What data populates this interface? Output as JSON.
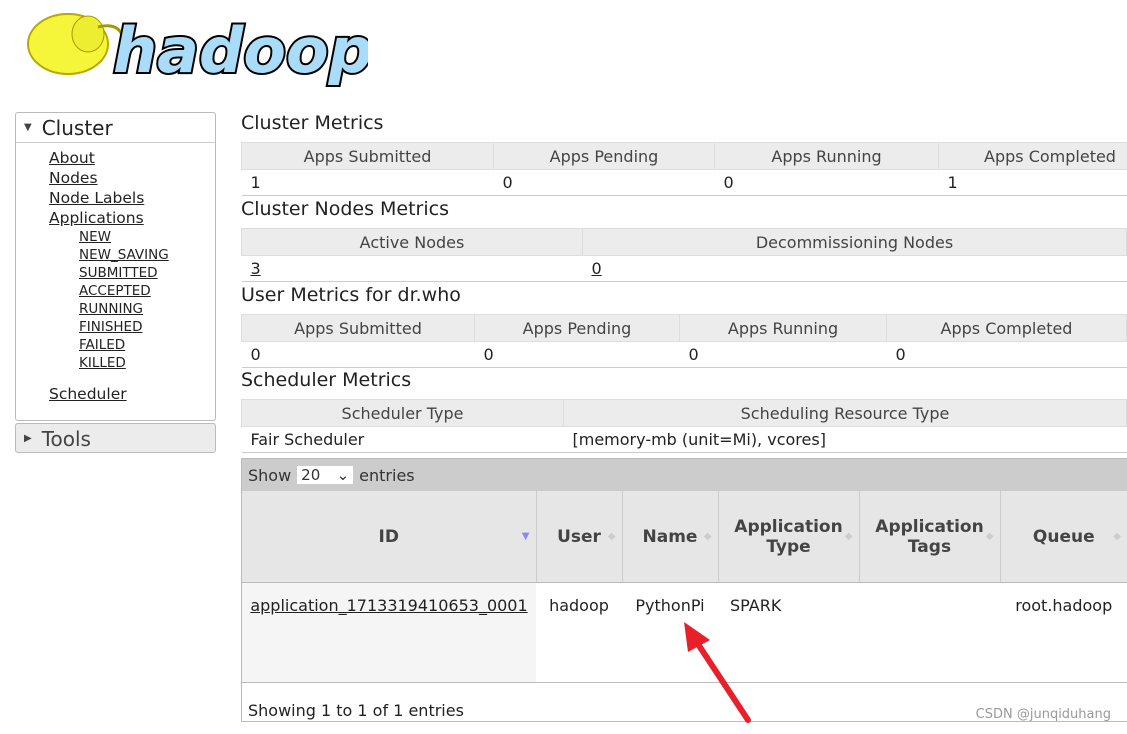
{
  "logo": {
    "text": "hadoop"
  },
  "sidebar": {
    "cluster": {
      "title": "Cluster",
      "items": [
        "About",
        "Nodes",
        "Node Labels",
        "Applications"
      ],
      "app_states": [
        "NEW",
        "NEW_SAVING",
        "SUBMITTED",
        "ACCEPTED",
        "RUNNING",
        "FINISHED",
        "FAILED",
        "KILLED"
      ],
      "scheduler": "Scheduler"
    },
    "tools": {
      "title": "Tools"
    }
  },
  "cluster_metrics": {
    "title": "Cluster Metrics",
    "headers": [
      "Apps Submitted",
      "Apps Pending",
      "Apps Running",
      "Apps Completed"
    ],
    "values": [
      "1",
      "0",
      "0",
      "1"
    ]
  },
  "nodes_metrics": {
    "title": "Cluster Nodes Metrics",
    "headers": [
      "Active Nodes",
      "Decommissioning Nodes"
    ],
    "values": [
      "3",
      "0"
    ]
  },
  "user_metrics": {
    "title": "User Metrics for dr.who",
    "headers": [
      "Apps Submitted",
      "Apps Pending",
      "Apps Running",
      "Apps Completed"
    ],
    "values": [
      "0",
      "0",
      "0",
      "0"
    ]
  },
  "scheduler_metrics": {
    "title": "Scheduler Metrics",
    "headers": [
      "Scheduler Type",
      "Scheduling Resource Type"
    ],
    "values": [
      "Fair Scheduler",
      "[memory-mb (unit=Mi), vcores]"
    ]
  },
  "apps_table": {
    "show": "Show",
    "page_size": "20",
    "entries": "entries",
    "headers": [
      "ID",
      "User",
      "Name",
      "Application Type",
      "Application Tags",
      "Queue"
    ],
    "rows": [
      {
        "id": "application_1713319410653_0001",
        "user": "hadoop",
        "name": "PythonPi",
        "type": "SPARK",
        "tags": "",
        "queue": "root.hadoop"
      }
    ],
    "footer": "Showing 1 to 1 of 1 entries"
  },
  "watermark": "CSDN @junqiduhang",
  "colors": {
    "arrow": "#e8202a",
    "header_bg": "#ececec"
  }
}
